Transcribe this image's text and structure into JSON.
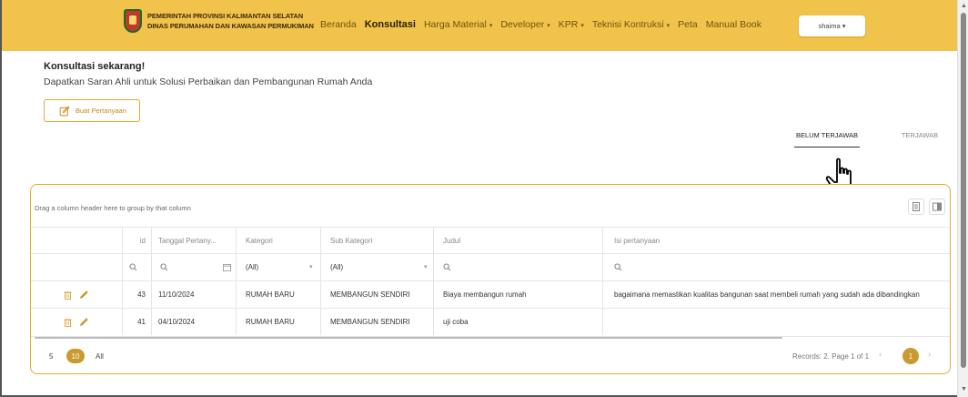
{
  "header": {
    "org_line1": "PEMERINTAH PROVINSI KALIMANTAN SELATAN",
    "org_line2": "DINAS PERUMAHAN DAN KAWASAN PERMUKIMAN",
    "nav": [
      {
        "label": "Beranda"
      },
      {
        "label": "Konsultasi"
      },
      {
        "label": "Harga Material"
      },
      {
        "label": "Developer"
      },
      {
        "label": "KPR"
      },
      {
        "label": "Teknisi Kontruksi"
      },
      {
        "label": "Peta"
      },
      {
        "label": "Manual Book"
      }
    ],
    "caret": "▾",
    "user": "shaima ▾",
    "brand_color": "#f2c34b"
  },
  "intro": {
    "title": "Konsultasi sekarang!",
    "subtitle": "Dapatkan Saran Ahli untuk Solusi Perbaikan dan Pembangunan Rumah Anda",
    "ask_button": "Buat Pertanyaan"
  },
  "tabs": [
    {
      "label": "BELUM TERJAWAB"
    },
    {
      "label": "TERJAWAB"
    }
  ],
  "grid": {
    "group_hint": "Drag a column header here to group by that column",
    "columns": [
      "id",
      "Tanggal Pertany...",
      "Kategori",
      "Sub Kategori",
      "Judul",
      "Isi pertanyaan"
    ],
    "filters": {
      "kategori": "(All)",
      "sub_kategori": "(All)"
    },
    "rows": [
      {
        "id": "43",
        "tanggal": "11/10/2024",
        "kategori": "RUMAH BARU",
        "sub": "MEMBANGUN SENDIRI",
        "judul": "Biaya membangun rumah",
        "isi": "bagaimana memastikan kualitas bangunan saat membeli rumah yang sudah ada dibandingkan"
      },
      {
        "id": "41",
        "tanggal": "04/10/2024",
        "kategori": "RUMAH BARU",
        "sub": "MEMBANGUN SENDIRI",
        "judul": "uji coba",
        "isi": ""
      }
    ],
    "page_sizes": [
      "5",
      "10",
      "All"
    ],
    "records": "Records: 2. Page 1 of 1",
    "current_page": "1",
    "accent": "#c99a2e"
  }
}
